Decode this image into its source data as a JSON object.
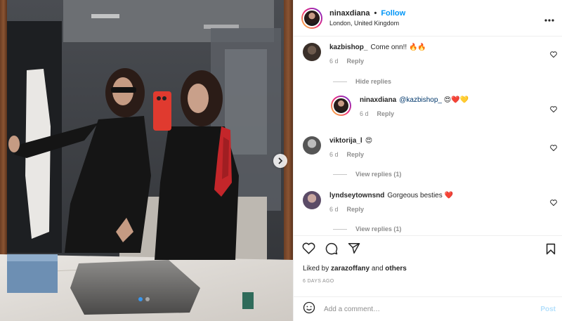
{
  "post": {
    "username": "ninaxdiana",
    "separator": "•",
    "follow_label": "Follow",
    "location": "London, United Kingdom"
  },
  "icons": {
    "more": "more-horizontal-icon",
    "like": "heart-icon",
    "comment": "comment-icon",
    "share": "paper-plane-icon",
    "save": "bookmark-icon",
    "emoji": "emoji-icon",
    "next": "chevron-right-icon"
  },
  "comments": [
    {
      "username": "kazbishop_",
      "text": "Come onn!! 🔥🔥",
      "age": "6 d",
      "reply_label": "Reply",
      "toggle": "Hide replies"
    },
    {
      "username": "ninaxdiana",
      "mention": "@kazbishop_",
      "text": " 😍❤️💛",
      "age": "6 d",
      "reply_label": "Reply"
    },
    {
      "username": "viktorija_l",
      "text": "😍",
      "age": "6 d",
      "reply_label": "Reply",
      "toggle": "View replies (1)"
    },
    {
      "username": "lyndseytownsnd",
      "text": "Gorgeous besties ❤️",
      "age": "6 d",
      "reply_label": "Reply",
      "toggle": "View replies (1)"
    }
  ],
  "likes": {
    "prefix": "Liked by",
    "user": "zarazoffany",
    "conj": "and",
    "others": "others"
  },
  "date": "6 DAYS AGO",
  "add_comment": {
    "placeholder": "Add a comment…",
    "post_label": "Post"
  },
  "carousel": {
    "slide_count": 2,
    "active_slide": 1
  },
  "colors": {
    "link": "#0095f6",
    "like_red": "#ed4956",
    "muted": "#8e8e8e"
  }
}
